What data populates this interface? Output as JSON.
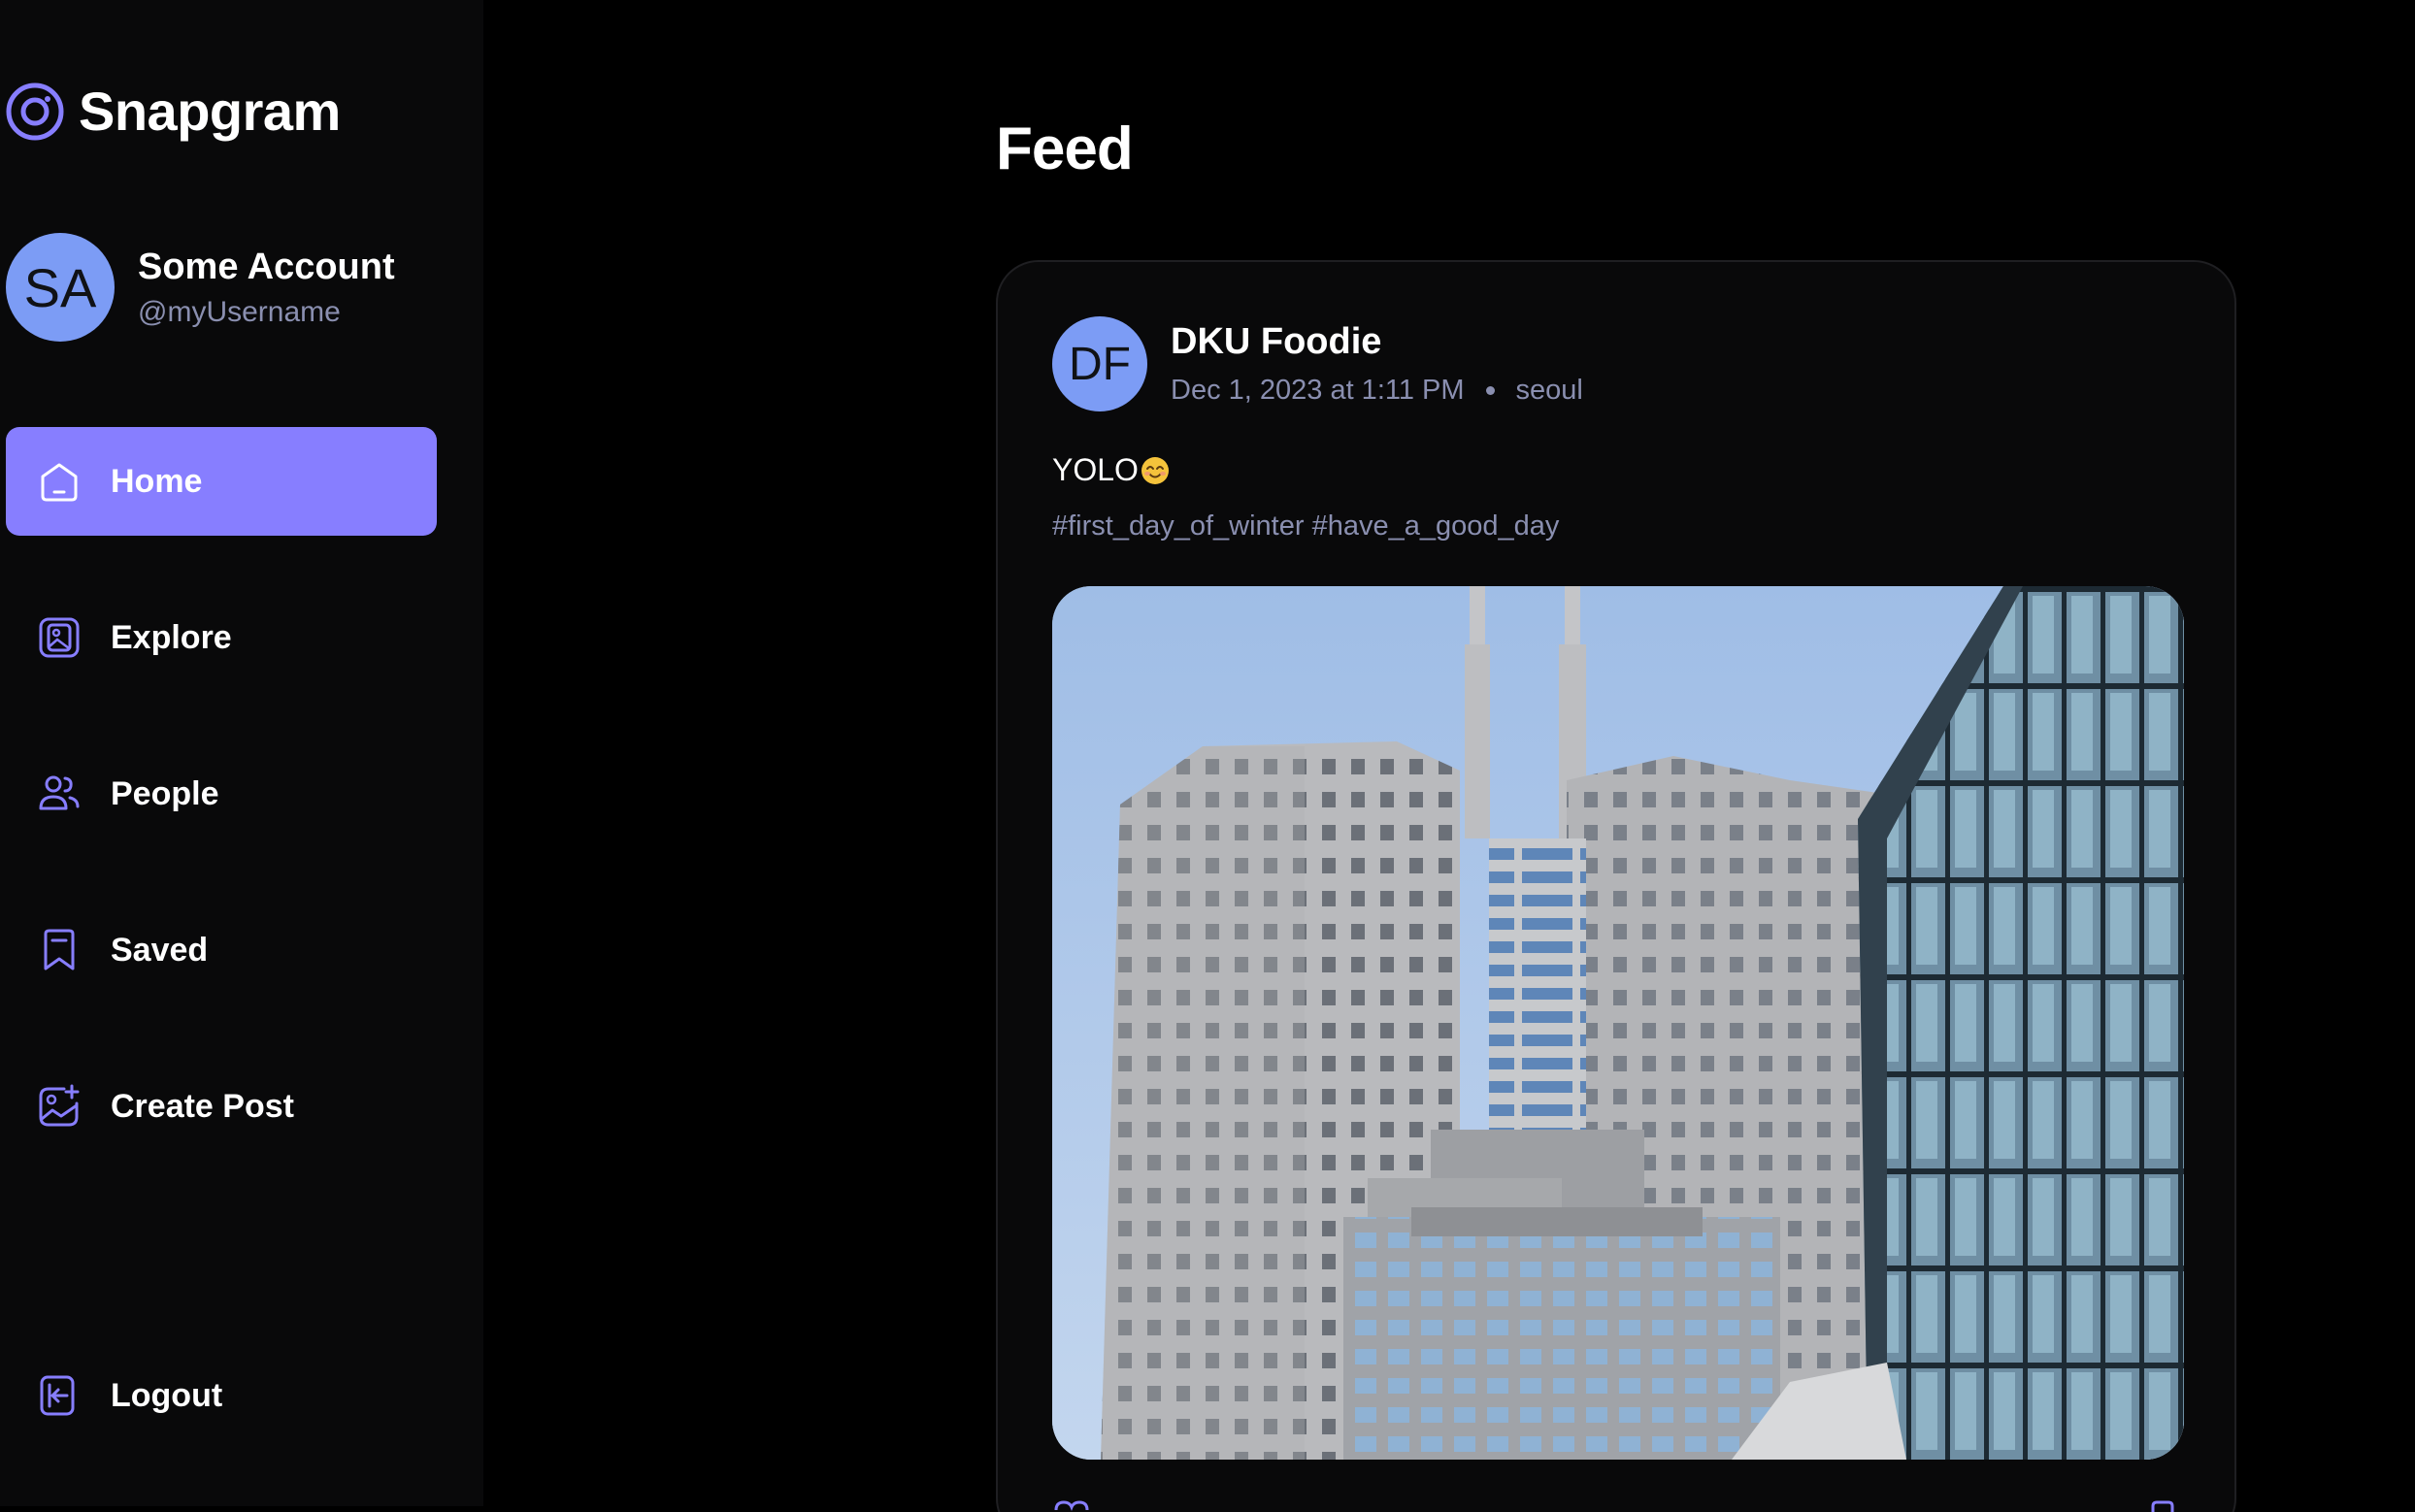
{
  "app": {
    "name": "Snapgram",
    "accent_color": "#877eff",
    "avatar_color": "#7c9cf5"
  },
  "profile": {
    "initials": "SA",
    "name": "Some Account",
    "username": "@myUsername"
  },
  "nav": {
    "items": [
      {
        "label": "Home",
        "icon": "home-icon",
        "active": true
      },
      {
        "label": "Explore",
        "icon": "gallery-icon",
        "active": false
      },
      {
        "label": "People",
        "icon": "people-icon",
        "active": false
      },
      {
        "label": "Saved",
        "icon": "bookmark-icon",
        "active": false
      },
      {
        "label": "Create Post",
        "icon": "gallery-add-icon",
        "active": false
      }
    ],
    "logout_label": "Logout"
  },
  "main": {
    "title": "Feed"
  },
  "post": {
    "author_initials": "DF",
    "author": "DKU Foodie",
    "date": "Dec 1, 2023 at 1:11 PM",
    "location": "seoul",
    "caption": "YOLO",
    "caption_emoji": "smiling-face-emoji",
    "tags": "#first_day_of_winter #have_a_good_day",
    "image": "photo of grey high-rise office towers under a blue sky"
  }
}
